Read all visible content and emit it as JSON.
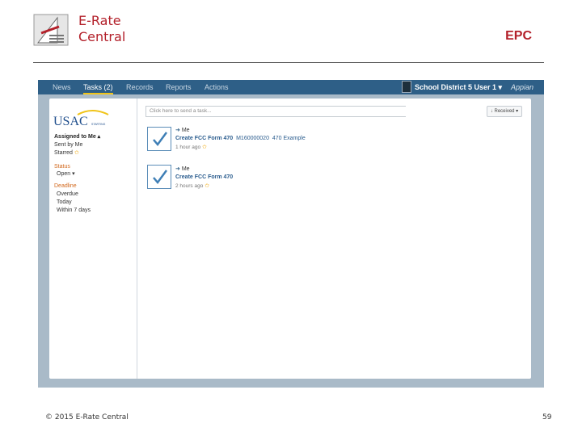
{
  "slide": {
    "brand_line1": "E-Rate",
    "brand_line2": "Central",
    "corner_title": "EPC",
    "footer": "© 2015 E-Rate Central",
    "page_number": "59"
  },
  "colors": {
    "brand_red": "#b3202a",
    "nav_blue": "#2e5f87",
    "accent_yellow": "#f0c419",
    "link_blue": "#2a5c8e",
    "filter_orange": "#d2691e"
  },
  "topnav": {
    "tabs": [
      {
        "label": "News"
      },
      {
        "label": "Tasks (2)",
        "active": true
      },
      {
        "label": "Records"
      },
      {
        "label": "Reports"
      },
      {
        "label": "Actions"
      }
    ],
    "user": "School District 5 User 1 ▾",
    "product": "Appian"
  },
  "sidebar": {
    "logo_text": "USAC",
    "logo_sub": "STARTING",
    "assigned": "Assigned to Me ▴",
    "sent": "Sent by Me",
    "starred": "Starred",
    "status_label": "Status",
    "status_value": "Open ▾",
    "deadline_label": "Deadline",
    "deadlines": [
      "Overdue",
      "Today",
      "Within 7 days"
    ]
  },
  "search": {
    "placeholder": "Click here to send a task..."
  },
  "sort_button": "↓ Received ▾",
  "tasks": [
    {
      "assignee": "Me",
      "title": "Create FCC Form 470",
      "number": "M160000020",
      "suffix": "470 Example",
      "age": "1 hour ago"
    },
    {
      "assignee": "Me",
      "title": "Create FCC Form 470",
      "number": "",
      "suffix": "",
      "age": "2 hours ago"
    }
  ]
}
